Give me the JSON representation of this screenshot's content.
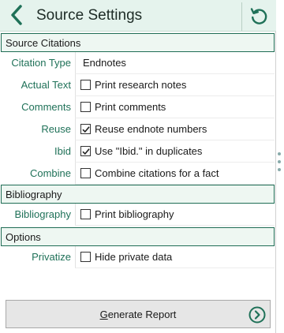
{
  "header": {
    "title": "Source Settings"
  },
  "sections": {
    "source_citations": "Source Citations",
    "bibliography": "Bibliography",
    "options": "Options"
  },
  "citations": {
    "citation_type": {
      "label": "Citation Type",
      "value": "Endnotes"
    },
    "actual_text": {
      "label": "Actual Text",
      "option": "Print research notes",
      "checked": false
    },
    "comments": {
      "label": "Comments",
      "option": "Print comments",
      "checked": false
    },
    "reuse": {
      "label": "Reuse",
      "option": "Reuse endnote numbers",
      "checked": true
    },
    "ibid": {
      "label": "Ibid",
      "option": "Use \"Ibid.\" in duplicates",
      "checked": true
    },
    "combine": {
      "label": "Combine",
      "option": "Combine citations for a fact",
      "checked": false
    }
  },
  "bibliography": {
    "bibliography": {
      "label": "Bibliography",
      "option": "Print bibliography",
      "checked": false
    }
  },
  "options": {
    "privatize": {
      "label": "Privatize",
      "option": "Hide private data",
      "checked": false
    }
  },
  "footer": {
    "generate_label_prefix": "G",
    "generate_label_rest": "enerate Report"
  },
  "icons": {
    "back": "chevron-left-icon",
    "refresh": "undo-icon",
    "generate": "circle-chevron-right-icon",
    "checkmark": "checkmark-icon"
  },
  "colors": {
    "accent": "#1f7158",
    "header_bg": "#e5f3ed",
    "section_border": "#1f6d55"
  }
}
